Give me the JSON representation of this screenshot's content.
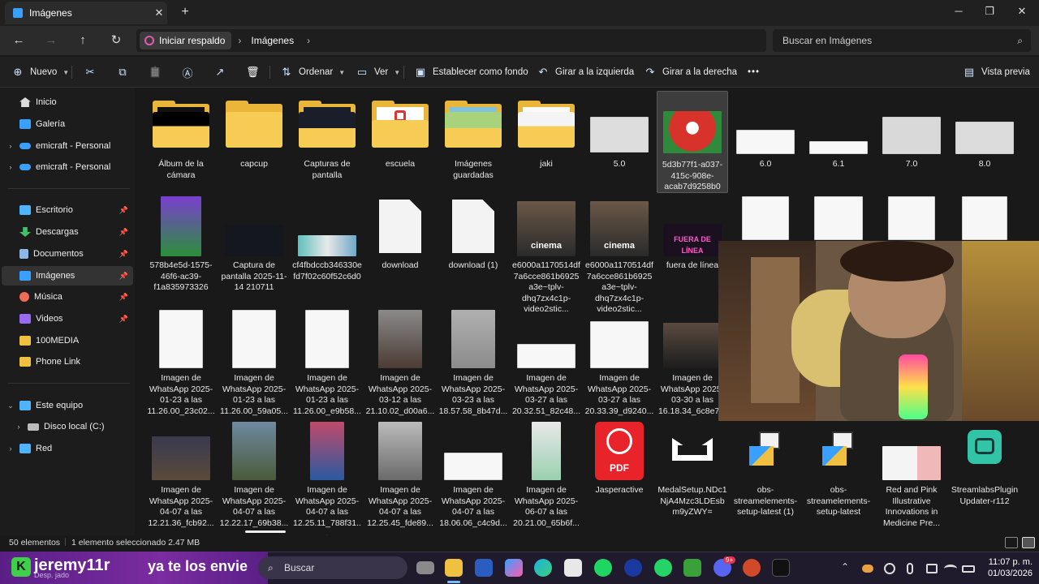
{
  "window": {
    "tab_title": "Imágenes",
    "tab_close": "✕",
    "new_tab": "+",
    "minimize": "─",
    "maximize": "❐",
    "close": "✕"
  },
  "addressbar": {
    "back": "←",
    "forward": "→",
    "up": "↑",
    "refresh": "↻",
    "breadcrumbs": [
      "Iniciar respaldo",
      "Imágenes"
    ],
    "separator": "›",
    "search_placeholder": "Buscar en Imágenes",
    "search_icon": "⌕"
  },
  "commandbar": {
    "new": "Nuevo",
    "sort": "Ordenar",
    "view": "Ver",
    "set_background": "Establecer como fondo",
    "rotate_left": "Girar a la izquierda",
    "rotate_right": "Girar a la derecha",
    "more": "•••",
    "preview": "Vista previa",
    "icons": {
      "new": "⊕",
      "cut": "✂",
      "copy": "⧉",
      "paste": "📋",
      "rename": "Ⓐ",
      "share": "↗",
      "delete": "🗑",
      "sort": "⇅",
      "view": "▭",
      "background": "▣",
      "rotate_left": "↶",
      "rotate_right": "↷",
      "preview": "▤"
    }
  },
  "sidebar": {
    "items": [
      {
        "label": "Inicio",
        "icon": "home-icon",
        "color": "#e8e8e8"
      },
      {
        "label": "Galería",
        "icon": "gallery-icon",
        "color": "#3aa0ff"
      },
      {
        "label": "emicraft - Personal",
        "icon": "cloud-icon",
        "color": "#3aa0ff"
      },
      {
        "label": "emicraft - Personal",
        "icon": "cloud-icon",
        "color": "#3aa0ff"
      },
      {
        "label": "Escritorio",
        "icon": "desktop-icon",
        "color": "#4fb3ff"
      },
      {
        "label": "Descargas",
        "icon": "download-icon",
        "color": "#3fc36a"
      },
      {
        "label": "Documentos",
        "icon": "documents-icon",
        "color": "#8fb8e8"
      },
      {
        "label": "Imágenes",
        "icon": "pictures-icon",
        "color": "#3aa0ff"
      },
      {
        "label": "Música",
        "icon": "music-icon",
        "color": "#f06a5a"
      },
      {
        "label": "Videos",
        "icon": "videos-icon",
        "color": "#9a6af0"
      },
      {
        "label": "100MEDIA",
        "icon": "folder-icon",
        "color": "#f0c040"
      },
      {
        "label": "Phone Link",
        "icon": "folder-icon",
        "color": "#f0c040"
      },
      {
        "label": "Este equipo",
        "icon": "pc-icon",
        "color": "#4fb3ff"
      },
      {
        "label": "Disco local (C:)",
        "icon": "drive-icon",
        "color": "#bbbbbb"
      },
      {
        "label": "Red",
        "icon": "network-icon",
        "color": "#4fb3ff"
      }
    ],
    "pin_glyph": "📌",
    "expand_glyph": "›",
    "expanded_glyph": "⌄"
  },
  "files": [
    {
      "name": "Álbum de la cámara"
    },
    {
      "name": "capcup"
    },
    {
      "name": "Capturas de pantalla"
    },
    {
      "name": "escuela"
    },
    {
      "name": "Imágenes guardadas"
    },
    {
      "name": "jaki"
    },
    {
      "name": "5.0"
    },
    {
      "name": "5d3b77f1-a037-415c-908e-acab7d9258b0"
    },
    {
      "name": "6.0"
    },
    {
      "name": "6.1"
    },
    {
      "name": "7.0"
    },
    {
      "name": "8.0"
    },
    {
      "name": "578b4e5d-1575-46f6-ac39-f1a835973326"
    },
    {
      "name": "Captura de pantalla 2025-11-14 210711"
    },
    {
      "name": "cf4fbdccb346330efd7f02c60f52c6d0"
    },
    {
      "name": "download"
    },
    {
      "name": "download (1)"
    },
    {
      "name": "e6000a1170514df7a6cce861b6925a3e~tplv-dhq7zx4c1p-video2stic...",
      "overlay": "cinema"
    },
    {
      "name": "e6000a1170514df7a6cce861b6925a3e~tplv-dhq7zx4c1p-video2stic...",
      "overlay": "cinema"
    },
    {
      "name": "fuera de línea",
      "overlay": "FUERA DE LÍNEA"
    },
    {
      "name": "Imagen de WhatsApp 2025-01-23 a las 11.26.00_23c02..."
    },
    {
      "name": "Imagen de WhatsApp 2025-01-23 a las 11.26.00_59a05..."
    },
    {
      "name": "Imagen de WhatsApp 2025-01-23 a las 11.26.00_e9b58..."
    },
    {
      "name": "Imagen de WhatsApp 2025-03-12 a las 21.10.02_d00a6..."
    },
    {
      "name": "Imagen de WhatsApp 2025-03-23 a las 18.57.58_8b47d..."
    },
    {
      "name": "Imagen de WhatsApp 2025-03-27 a las 20.32.51_82c48..."
    },
    {
      "name": "Imagen de WhatsApp 2025-03-27 a las 20.33.39_d9240..."
    },
    {
      "name": "Imagen de WhatsApp 2025-03-30 a las 16.18.34_6c8e7..."
    },
    {
      "name": "Imagen de WhatsApp 2025-04-07 a las 12.21.36_fcb92..."
    },
    {
      "name": "Imagen de WhatsApp 2025-04-07 a las 12.22.17_69b38..."
    },
    {
      "name": "Imagen de WhatsApp 2025-04-07 a las 12.25.11_788f31..."
    },
    {
      "name": "Imagen de WhatsApp 2025-04-07 a las 12.25.45_fde89..."
    },
    {
      "name": "Imagen de WhatsApp 2025-04-07 a las 18.06.06_c4c9d..."
    },
    {
      "name": "Imagen de WhatsApp 2025-06-07 a las 20.21.00_65b6f..."
    },
    {
      "name": "Jasperactive",
      "overlay": "PDF"
    },
    {
      "name": "MedalSetup.NDc1NjA4Mzc3LDEsbm9yZWY="
    },
    {
      "name": "obs-streamelements-setup-latest (1)"
    },
    {
      "name": "obs-streamelements-setup-latest"
    },
    {
      "name": "Red and Pink Illustrative Innovations in Medicine Pre..."
    },
    {
      "name": "StreamlabsPluginUpdater-r112"
    }
  ],
  "statusbar": {
    "count": "50 elementos",
    "selection": "1 elemento seleccionado  2.47 MB"
  },
  "taskbar": {
    "chat_badge": "K",
    "chat_user": "jeremy11r",
    "chat_message": "ya te los envie",
    "chat_sub": "Desp. jado",
    "search": "Buscar",
    "search_icon": "⌕",
    "tray_up": "⌃",
    "time": "11:07 p. m.",
    "date": "01/03/2026",
    "notif_badge": "9+"
  }
}
